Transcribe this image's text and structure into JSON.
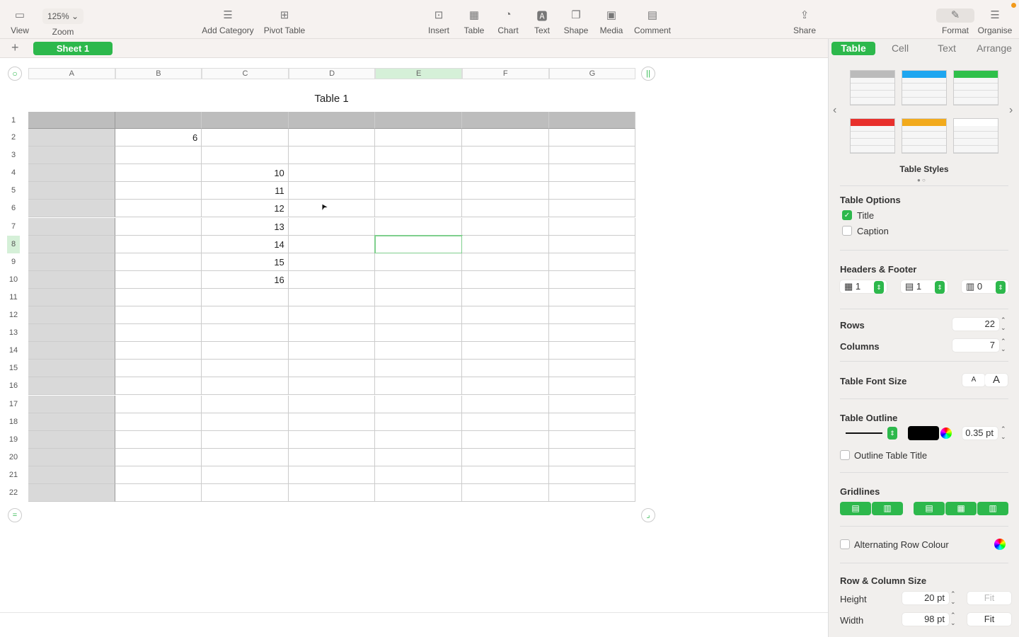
{
  "toolbar": {
    "view": "View",
    "zoom_value": "125%",
    "zoom": "Zoom",
    "add_category": "Add Category",
    "pivot_table": "Pivot Table",
    "insert": "Insert",
    "table": "Table",
    "chart": "Chart",
    "text": "Text",
    "shape": "Shape",
    "media": "Media",
    "comment": "Comment",
    "share": "Share",
    "format": "Format",
    "organise": "Organise"
  },
  "sheets": {
    "active": "Sheet 1"
  },
  "table": {
    "title": "Table 1",
    "columns": [
      "A",
      "B",
      "C",
      "D",
      "E",
      "F",
      "G"
    ],
    "row_count": 22,
    "selected_cell": "E8",
    "cells": [
      {
        "ref": "B2",
        "value": "6"
      },
      {
        "ref": "C4",
        "value": "10"
      },
      {
        "ref": "C5",
        "value": "11"
      },
      {
        "ref": "C6",
        "value": "12"
      },
      {
        "ref": "C7",
        "value": "13"
      },
      {
        "ref": "C8",
        "value": "14"
      },
      {
        "ref": "C9",
        "value": "15"
      },
      {
        "ref": "C10",
        "value": "16"
      }
    ]
  },
  "panel": {
    "tabs": [
      "Table",
      "Cell",
      "Text",
      "Arrange"
    ],
    "styles_label": "Table Styles",
    "style_colors": [
      "#bbbbbb",
      "#1ea6f0",
      "#2fc04a",
      "#e8302c",
      "#f2aa1c",
      "#ffffff"
    ],
    "options_label": "Table Options",
    "title_opt": "Title",
    "caption_opt": "Caption",
    "headers_label": "Headers & Footer",
    "header_rows": "1",
    "header_cols": "1",
    "footer_rows": "0",
    "rows_label": "Rows",
    "rows": "22",
    "columns_label": "Columns",
    "columns": "7",
    "font_size_label": "Table Font Size",
    "font_small": "A",
    "font_large": "A",
    "outline_label": "Table Outline",
    "outline_width": "0.35 pt",
    "outline_title": "Outline Table Title",
    "gridlines_label": "Gridlines",
    "alt_row": "Alternating Row Colour",
    "size_label": "Row & Column Size",
    "height_label": "Height",
    "height": "20 pt",
    "width_label": "Width",
    "width": "98 pt",
    "fit": "Fit"
  }
}
